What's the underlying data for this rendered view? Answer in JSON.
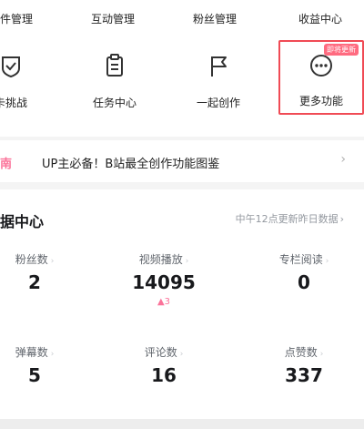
{
  "top_row": {
    "items": [
      {
        "label": "件管理"
      },
      {
        "label": "互动管理"
      },
      {
        "label": "粉丝管理"
      },
      {
        "label": "收益中心"
      }
    ]
  },
  "tools": {
    "items": [
      {
        "label": "卡挑战",
        "icon": "challenge-shield-icon"
      },
      {
        "label": "任务中心",
        "icon": "clipboard-icon"
      },
      {
        "label": "一起创作",
        "icon": "flag-icon"
      },
      {
        "label": "更多功能",
        "icon": "more-dots-icon",
        "badge": "即将更新"
      }
    ]
  },
  "guide": {
    "tag": "南",
    "text": "UP主必备！B站最全创作功能图鉴",
    "chevron": "›"
  },
  "data_center": {
    "title": "据中心",
    "note": "中午12点更新昨日数据",
    "note_chevron": "›",
    "stats": [
      {
        "label": "粉丝数",
        "value": "2",
        "delta": ""
      },
      {
        "label": "视频播放",
        "value": "14095",
        "delta": "▲3"
      },
      {
        "label": "专栏阅读",
        "value": "0",
        "delta": ""
      },
      {
        "label": "弹幕数",
        "value": "5",
        "delta": ""
      },
      {
        "label": "评论数",
        "value": "16",
        "delta": ""
      },
      {
        "label": "点赞数",
        "value": "337",
        "delta": ""
      }
    ]
  },
  "colors": {
    "accent_pink": "#fb7299",
    "highlight_red": "#f04b55",
    "text_primary": "#18191c",
    "text_secondary": "#61666d"
  }
}
